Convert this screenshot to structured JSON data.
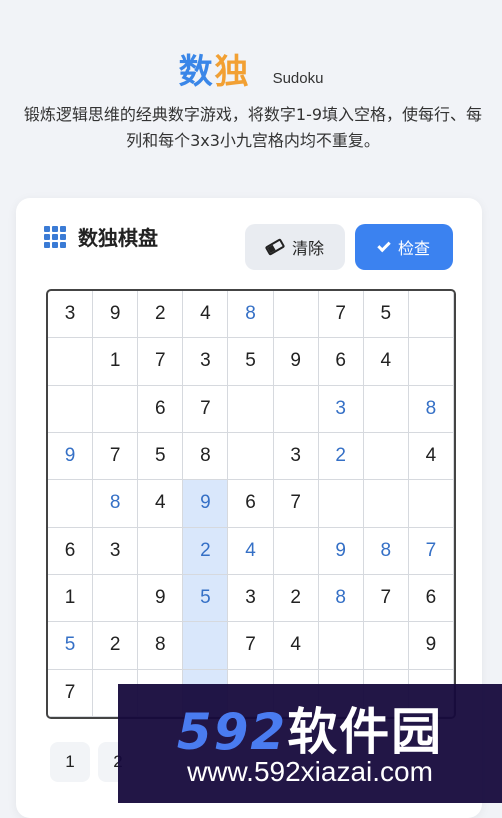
{
  "header": {
    "title": "数独",
    "subtitle": "Sudoku",
    "description": "锻炼逻辑思维的经典数字游戏，将数字1-9填入空格，使每行、每列和每个3x3小九宫格内均不重复。"
  },
  "board_card": {
    "title": "数独棋盘",
    "clear_label": "清除",
    "check_label": "检查"
  },
  "board": {
    "rows": [
      [
        {
          "v": "3",
          "u": false
        },
        {
          "v": "9",
          "u": false
        },
        {
          "v": "2",
          "u": false
        },
        {
          "v": "4",
          "u": false
        },
        {
          "v": "8",
          "u": true
        },
        {
          "v": "",
          "u": false
        },
        {
          "v": "7",
          "u": false
        },
        {
          "v": "5",
          "u": false
        },
        {
          "v": "",
          "u": false
        }
      ],
      [
        {
          "v": "",
          "u": false
        },
        {
          "v": "1",
          "u": false
        },
        {
          "v": "7",
          "u": false
        },
        {
          "v": "3",
          "u": false
        },
        {
          "v": "5",
          "u": false
        },
        {
          "v": "9",
          "u": false
        },
        {
          "v": "6",
          "u": false
        },
        {
          "v": "4",
          "u": false
        },
        {
          "v": "",
          "u": false
        }
      ],
      [
        {
          "v": "",
          "u": false
        },
        {
          "v": "",
          "u": false
        },
        {
          "v": "6",
          "u": false
        },
        {
          "v": "7",
          "u": false
        },
        {
          "v": "",
          "u": false
        },
        {
          "v": "",
          "u": false
        },
        {
          "v": "3",
          "u": true
        },
        {
          "v": "",
          "u": false
        },
        {
          "v": "8",
          "u": true
        }
      ],
      [
        {
          "v": "9",
          "u": true
        },
        {
          "v": "7",
          "u": false
        },
        {
          "v": "5",
          "u": false
        },
        {
          "v": "8",
          "u": false
        },
        {
          "v": "",
          "u": false
        },
        {
          "v": "3",
          "u": false
        },
        {
          "v": "2",
          "u": true
        },
        {
          "v": "",
          "u": false
        },
        {
          "v": "4",
          "u": false
        }
      ],
      [
        {
          "v": "",
          "u": false
        },
        {
          "v": "8",
          "u": true
        },
        {
          "v": "4",
          "u": false
        },
        {
          "v": "9",
          "u": true
        },
        {
          "v": "6",
          "u": false
        },
        {
          "v": "7",
          "u": false
        },
        {
          "v": "",
          "u": false
        },
        {
          "v": "",
          "u": false
        },
        {
          "v": "",
          "u": false
        }
      ],
      [
        {
          "v": "6",
          "u": false
        },
        {
          "v": "3",
          "u": false
        },
        {
          "v": "",
          "u": false
        },
        {
          "v": "2",
          "u": true
        },
        {
          "v": "4",
          "u": true
        },
        {
          "v": "",
          "u": false
        },
        {
          "v": "9",
          "u": true
        },
        {
          "v": "8",
          "u": true
        },
        {
          "v": "7",
          "u": true
        }
      ],
      [
        {
          "v": "1",
          "u": false
        },
        {
          "v": "",
          "u": false
        },
        {
          "v": "9",
          "u": false
        },
        {
          "v": "5",
          "u": true
        },
        {
          "v": "3",
          "u": false
        },
        {
          "v": "2",
          "u": false
        },
        {
          "v": "8",
          "u": true
        },
        {
          "v": "7",
          "u": false
        },
        {
          "v": "6",
          "u": false
        }
      ],
      [
        {
          "v": "5",
          "u": true
        },
        {
          "v": "2",
          "u": false
        },
        {
          "v": "8",
          "u": false
        },
        {
          "v": "",
          "u": false
        },
        {
          "v": "7",
          "u": false
        },
        {
          "v": "4",
          "u": false
        },
        {
          "v": "",
          "u": false
        },
        {
          "v": "",
          "u": false
        },
        {
          "v": "9",
          "u": false
        }
      ],
      [
        {
          "v": "7",
          "u": false
        },
        {
          "v": "",
          "u": false
        },
        {
          "v": "",
          "u": false
        },
        {
          "v": "",
          "u": false
        },
        {
          "v": "",
          "u": false
        },
        {
          "v": "",
          "u": false
        },
        {
          "v": "",
          "u": false
        },
        {
          "v": "",
          "u": false
        },
        {
          "v": "",
          "u": false
        }
      ]
    ],
    "highlighted_column": 3,
    "highlighted_rows": [
      4,
      5,
      6,
      7,
      8
    ]
  },
  "number_pad": [
    "1",
    "2"
  ],
  "watermark": {
    "logo_digits": "592",
    "logo_text": "软件园",
    "url": "www.592xiazai.com"
  },
  "colors": {
    "accent": "#3b82f0",
    "user_digit": "#3570c6",
    "highlight": "#d9e7fb"
  }
}
